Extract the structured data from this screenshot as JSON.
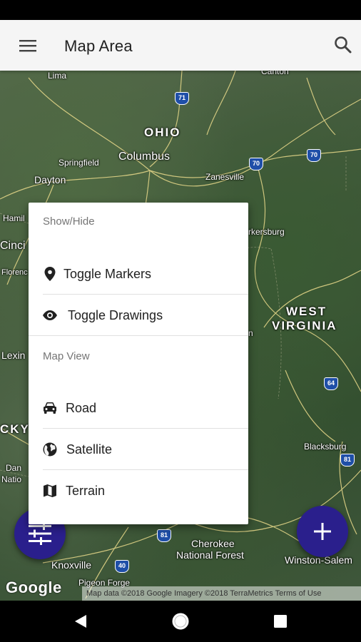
{
  "app_bar": {
    "title": "Map Area",
    "menu_icon": "menu-icon",
    "search_icon": "search-icon",
    "background": "#f5f5f5"
  },
  "map": {
    "type": "Satellite",
    "labels": {
      "lima": "Lima",
      "canton": "Canton",
      "ohio": "OHIO",
      "springfield": "Springfield",
      "columbus": "Columbus",
      "dayton": "Dayton",
      "zanesville": "Zanesville",
      "hamilton": "Hamil",
      "cincinnati": "Cinci",
      "florence": "Florenc",
      "parkersburg": "rkersburg",
      "west_virginia_1": "WEST",
      "west_virginia_2": "VIRGINIA",
      "lexington": "Lexin",
      "kentucky": "CKY",
      "danville_1": "Dan",
      "danville_2": "Natio",
      "blacksburg": "Blacksburg",
      "cherokee_1": "Cherokee",
      "cherokee_2": "National Forest",
      "knoxville": "Knoxville",
      "pigeon_forge": "Pigeon Forge",
      "winston_salem": "Winston-Salem",
      "charleston_partial": "n"
    },
    "shields": {
      "i71": "71",
      "i70a": "70",
      "i70b": "70",
      "i64": "64",
      "i81a": "81",
      "i81b": "81",
      "i40": "40"
    },
    "google_logo": "Google",
    "attribution": "Map data ©2018 Google Imagery ©2018 TerraMetrics   Terms of Use"
  },
  "popup": {
    "section_show_hide": "Show/Hide",
    "toggle_markers": "Toggle Markers",
    "toggle_drawings": "Toggle Drawings",
    "section_map_view": "Map View",
    "road": "Road",
    "satellite": "Satellite",
    "terrain": "Terrain",
    "icons": {
      "markers": "location-pin-icon",
      "drawings": "eye-icon",
      "road": "car-icon",
      "satellite": "globe-icon",
      "terrain": "map-icon"
    }
  },
  "fabs": {
    "filter_icon": "tune-icon",
    "add_icon": "plus-icon",
    "color": "#2a1f8c"
  },
  "nav_bar": {
    "back_icon": "back-triangle-icon",
    "home_icon": "home-circle-icon",
    "recents_icon": "recents-square-icon"
  }
}
